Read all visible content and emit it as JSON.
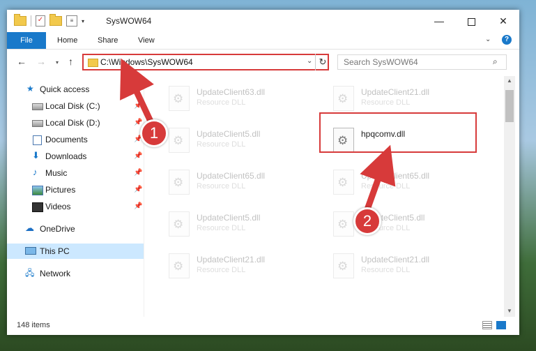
{
  "window": {
    "title": "SysWOW64"
  },
  "ribbon": {
    "tabs": [
      "File",
      "Home",
      "Share",
      "View"
    ]
  },
  "address": {
    "path": "C:\\Windows\\SysWOW64",
    "search_placeholder": "Search SysWOW64"
  },
  "sidebar": {
    "items": [
      {
        "label": "Quick access",
        "icon": "star-icon",
        "pinned": false
      },
      {
        "label": "Local Disk (C:)",
        "icon": "drive-icon",
        "pinned": true
      },
      {
        "label": "Local Disk (D:)",
        "icon": "drive-icon",
        "pinned": true
      },
      {
        "label": "Documents",
        "icon": "documents-icon",
        "pinned": true
      },
      {
        "label": "Downloads",
        "icon": "download-icon",
        "pinned": true
      },
      {
        "label": "Music",
        "icon": "music-icon",
        "pinned": true
      },
      {
        "label": "Pictures",
        "icon": "pictures-icon",
        "pinned": true
      },
      {
        "label": "Videos",
        "icon": "videos-icon",
        "pinned": true
      },
      {
        "label": "OneDrive",
        "icon": "cloud-icon",
        "pinned": false
      },
      {
        "label": "This PC",
        "icon": "computer-icon",
        "pinned": false,
        "selected": true
      },
      {
        "label": "Network",
        "icon": "network-icon",
        "pinned": false
      }
    ]
  },
  "files": [
    {
      "name": "UpdateClient63.dll",
      "type": "Resource DLL"
    },
    {
      "name": "UpdateClient21.dll",
      "type": "Resource DLL"
    },
    {
      "name": "UpdateClient5.dll",
      "type": "Resource DLL"
    },
    {
      "name": "hpqcomv.dll",
      "type": "",
      "highlighted": true
    },
    {
      "name": "UpdateClient65.dll",
      "type": "Resource DLL"
    },
    {
      "name": "UpdateClient65.dll",
      "type": "Resource DLL"
    },
    {
      "name": "UpdateClient5.dll",
      "type": "Resource DLL"
    },
    {
      "name": "UpdateClient5.dll",
      "type": "Resource DLL"
    },
    {
      "name": "UpdateClient21.dll",
      "type": "Resource DLL"
    },
    {
      "name": "UpdateClient21.dll",
      "type": "Resource DLL"
    }
  ],
  "status": {
    "item_count": "148 items"
  },
  "annotations": {
    "step1": "1",
    "step2": "2",
    "color": "#d73a3a"
  },
  "colors": {
    "accent": "#1979ca",
    "selection": "#cce8ff"
  }
}
